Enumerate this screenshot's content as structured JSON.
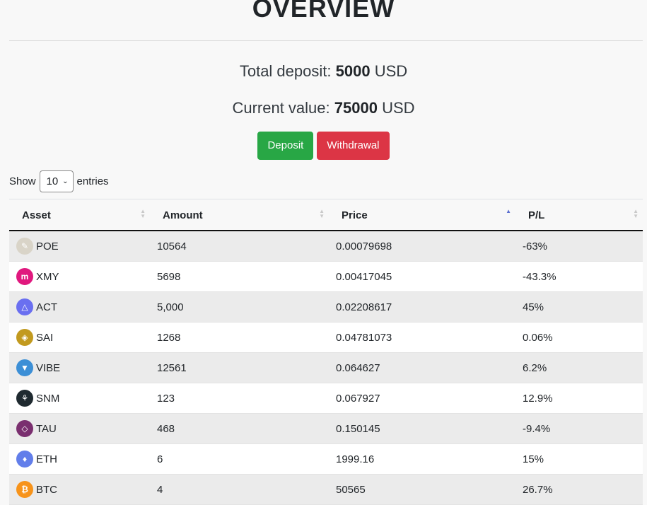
{
  "page_title": "OVERVIEW",
  "summary": {
    "deposit_label": "Total deposit:",
    "deposit_value": "5000",
    "deposit_unit": "USD",
    "current_label": "Current value:",
    "current_value": "75000",
    "current_unit": "USD"
  },
  "buttons": {
    "deposit": "Deposit",
    "withdrawal": "Withdrawal"
  },
  "length_menu": {
    "show": "Show",
    "selected": "10",
    "entries": "entries"
  },
  "table": {
    "headers": {
      "asset": "Asset",
      "amount": "Amount",
      "price": "Price",
      "pl": "P/L"
    },
    "sorted_column": "price",
    "rows": [
      {
        "asset": "POE",
        "amount": "10564",
        "price": "0.00079698",
        "pl": "-63%",
        "icon": "poe-coin-icon",
        "color": "#d9d4c8",
        "glyph": "✎"
      },
      {
        "asset": "XMY",
        "amount": "5698",
        "price": "0.00417045",
        "pl": "-43.3%",
        "icon": "xmy-coin-icon",
        "color": "#e0187e",
        "glyph": "m"
      },
      {
        "asset": "ACT",
        "amount": "5,000",
        "price": "0.02208617",
        "pl": "45%",
        "icon": "act-coin-icon",
        "color": "#6a6ff0",
        "glyph": "△"
      },
      {
        "asset": "SAI",
        "amount": "1268",
        "price": "0.04781073",
        "pl": "0.06%",
        "icon": "sai-coin-icon",
        "color": "#c29a1f",
        "glyph": "◈"
      },
      {
        "asset": "VIBE",
        "amount": "12561",
        "price": "0.064627",
        "pl": "6.2%",
        "icon": "vibe-coin-icon",
        "color": "#3c8fd6",
        "glyph": "▼"
      },
      {
        "asset": "SNM",
        "amount": "123",
        "price": "0.067927",
        "pl": "12.9%",
        "icon": "snm-coin-icon",
        "color": "#1f2a30",
        "glyph": "⚘"
      },
      {
        "asset": "TAU",
        "amount": "468",
        "price": "0.150145",
        "pl": "-9.4%",
        "icon": "tau-coin-icon",
        "color": "#7a2f6f",
        "glyph": "◇"
      },
      {
        "asset": "ETH",
        "amount": "6",
        "price": "1999.16",
        "pl": "15%",
        "icon": "eth-coin-icon",
        "color": "#627eea",
        "glyph": "♦"
      },
      {
        "asset": "BTC",
        "amount": "4",
        "price": "50565",
        "pl": "26.7%",
        "icon": "btc-coin-icon",
        "color": "#f7931a",
        "glyph": "₿"
      }
    ]
  }
}
